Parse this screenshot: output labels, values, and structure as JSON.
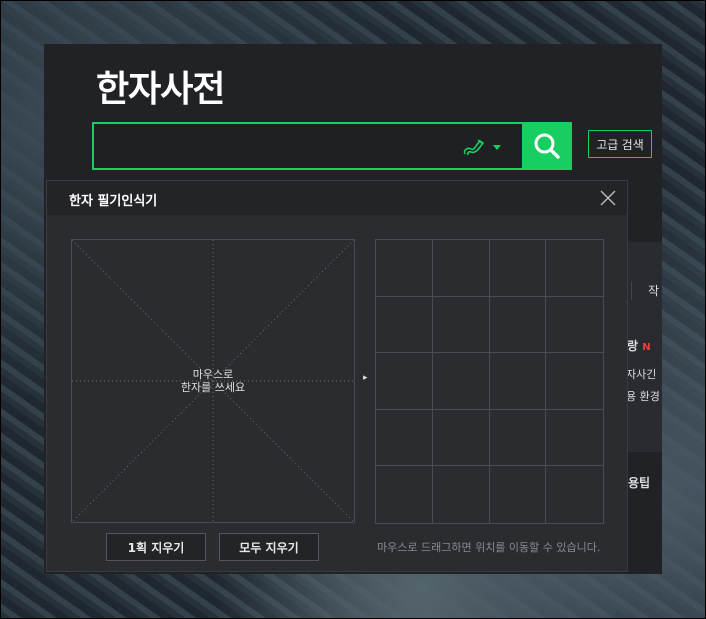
{
  "app_title": "한자사전",
  "search": {
    "value": "",
    "placeholder": ""
  },
  "advanced_search_label": "고급 검색",
  "right_peek": {
    "tab_char": "작",
    "new_item_char": "랑",
    "new_badge": "N",
    "line1": "자사긴",
    "line2": "용 환경",
    "tips": "용팁"
  },
  "popup": {
    "title": "한자 필기인식기",
    "draw_hint_line1": "마우스로",
    "draw_hint_line2": "한자를 쓰세요",
    "arrow": "▸",
    "clear_one_label": "1획 지우기",
    "clear_all_label": "모두 지우기",
    "drag_hint": "마우스로 드래그하면 위치를 이동할 수 있습니다."
  },
  "colors": {
    "accent": "#19ce60",
    "badge_red": "#e2453c"
  }
}
